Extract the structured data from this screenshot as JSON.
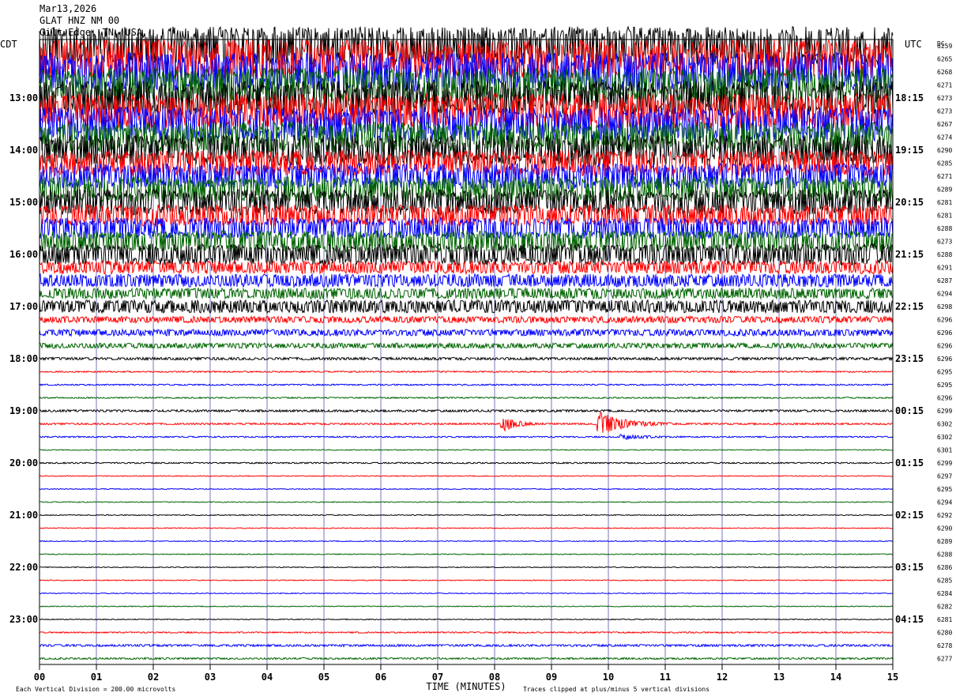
{
  "header": {
    "date": "Mar13,2026",
    "station": "GLAT HNZ NM 00",
    "location": "Gilt Edge, TN, USA"
  },
  "labels": {
    "left_zone": "CDT",
    "right_zone": "UTC",
    "dc": "DC",
    "xlabel": "TIME (MINUTES)",
    "scale_note": "Each Vertical Division =  200.00 microvolts",
    "clip_note": "Traces clipped at plus/minus 5 vertical divisions"
  },
  "chart_data": {
    "type": "line",
    "xlabel": "TIME (MINUTES)",
    "xlim": [
      0,
      15
    ],
    "x_ticks": [
      "00",
      "01",
      "02",
      "03",
      "04",
      "05",
      "06",
      "07",
      "08",
      "09",
      "10",
      "11",
      "12",
      "13",
      "14",
      "15"
    ],
    "left_hour_labels": [
      "13:00",
      "14:00",
      "15:00",
      "16:00",
      "17:00",
      "18:00",
      "19:00",
      "20:00",
      "21:00",
      "22:00",
      "23:00"
    ],
    "right_hour_labels": [
      "18:15",
      "19:15",
      "20:15",
      "21:15",
      "22:15",
      "23:15",
      "00:15",
      "01:15",
      "02:15",
      "03:15",
      "04:15"
    ],
    "trace_colors": [
      "#000000",
      "#ff0000",
      "#0000ff",
      "#006400"
    ],
    "dc_values": [
      "6259",
      "6265",
      "6268",
      "6271",
      "6273",
      "6273",
      "6267",
      "6274",
      "6290",
      "6285",
      "6271",
      "6289",
      "6281",
      "6281",
      "6288",
      "6273",
      "6288",
      "6291",
      "6287",
      "6294",
      "6298",
      "6296",
      "6296",
      "6296",
      "6296",
      "6295",
      "6295",
      "6296",
      "6299",
      "6302",
      "6302",
      "6301",
      "6299",
      "6297",
      "6295",
      "6294",
      "6292",
      "6290",
      "6289",
      "6288",
      "6286",
      "6285",
      "6284",
      "6282",
      "6281",
      "6280",
      "6278",
      "6277"
    ],
    "trace_activity": [
      9,
      9,
      9,
      8,
      8,
      8,
      8,
      7,
      7,
      6,
      6,
      6,
      6,
      5,
      5,
      5,
      5,
      3,
      3,
      2.5,
      3,
      1.5,
      1.5,
      1.2,
      0.6,
      0.3,
      0.3,
      0.3,
      0.5,
      0.4,
      0.3,
      0.2,
      0.3,
      0.2,
      0.2,
      0.2,
      0.2,
      0.2,
      0.2,
      0.2,
      0.2,
      0.2,
      0.2,
      0.2,
      0.2,
      0.3,
      0.5,
      0.4
    ],
    "events": [
      {
        "trace": 29,
        "minute": 8.2,
        "amplitude": 3,
        "duration_min": 0.6
      },
      {
        "trace": 29,
        "minute": 9.9,
        "amplitude": 5,
        "duration_min": 1.2
      },
      {
        "trace": 30,
        "minute": 10.3,
        "amplitude": 1,
        "duration_min": 1.0
      }
    ]
  }
}
